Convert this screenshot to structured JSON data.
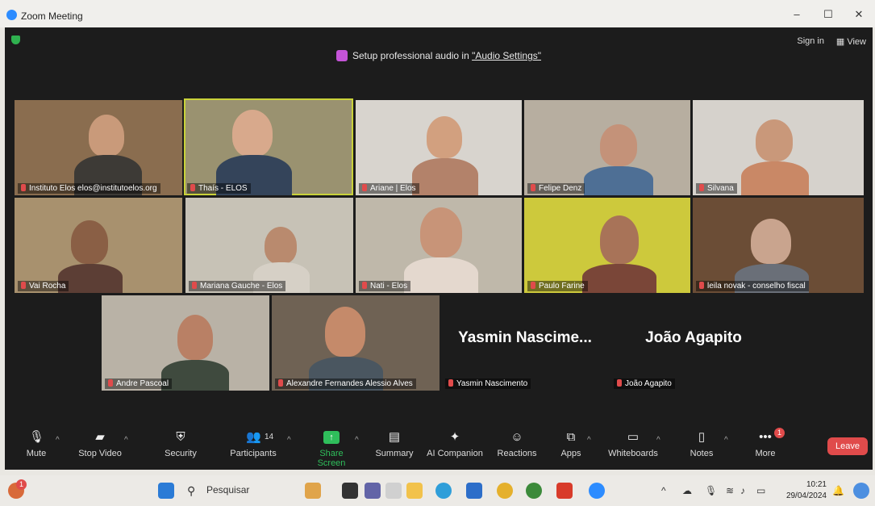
{
  "window": {
    "title": "Zoom Meeting",
    "minimize": "–",
    "maximize": "☐",
    "close": "✕",
    "accent": "#2d8cff"
  },
  "header": {
    "sign_in": "Sign in",
    "view": "View",
    "banner_prefix": "Setup professional audio in ",
    "banner_link": "\"Audio Settings\""
  },
  "participants": [
    {
      "name": "Instituto Elos elos@institutoelos.org"
    },
    {
      "name": "Thaís - ELOS"
    },
    {
      "name": "Ariane | Elos"
    },
    {
      "name": "Felipe Denz"
    },
    {
      "name": "Silvana"
    },
    {
      "name": "Vai Rocha"
    },
    {
      "name": "Mariana Gauche - Elos"
    },
    {
      "name": "Nati - Elos"
    },
    {
      "name": "Paulo Farine"
    },
    {
      "name": "leila novak - conselho fiscal"
    },
    {
      "name": "Andre Pascoal"
    },
    {
      "name": "Alexandre Fernandes Alessio Alves"
    },
    {
      "name": "Yasmin Nascimento",
      "display": "Yasmin  Nascime..."
    },
    {
      "name": "João Agapito",
      "display": "João Agapito"
    }
  ],
  "toolbar": {
    "mute": "Mute",
    "stop_video": "Stop Video",
    "security": "Security",
    "participants": "Participants",
    "participants_count": "14",
    "share_screen": "Share Screen",
    "summary": "Summary",
    "ai_companion": "AI Companion",
    "reactions": "Reactions",
    "apps": "Apps",
    "whiteboards": "Whiteboards",
    "notes": "Notes",
    "more": "More",
    "more_badge": "1",
    "leave": "Leave"
  },
  "taskbar": {
    "search_placeholder": "Pesquisar",
    "time": "10:21",
    "date": "29/04/2024",
    "notification_badge": "1"
  }
}
